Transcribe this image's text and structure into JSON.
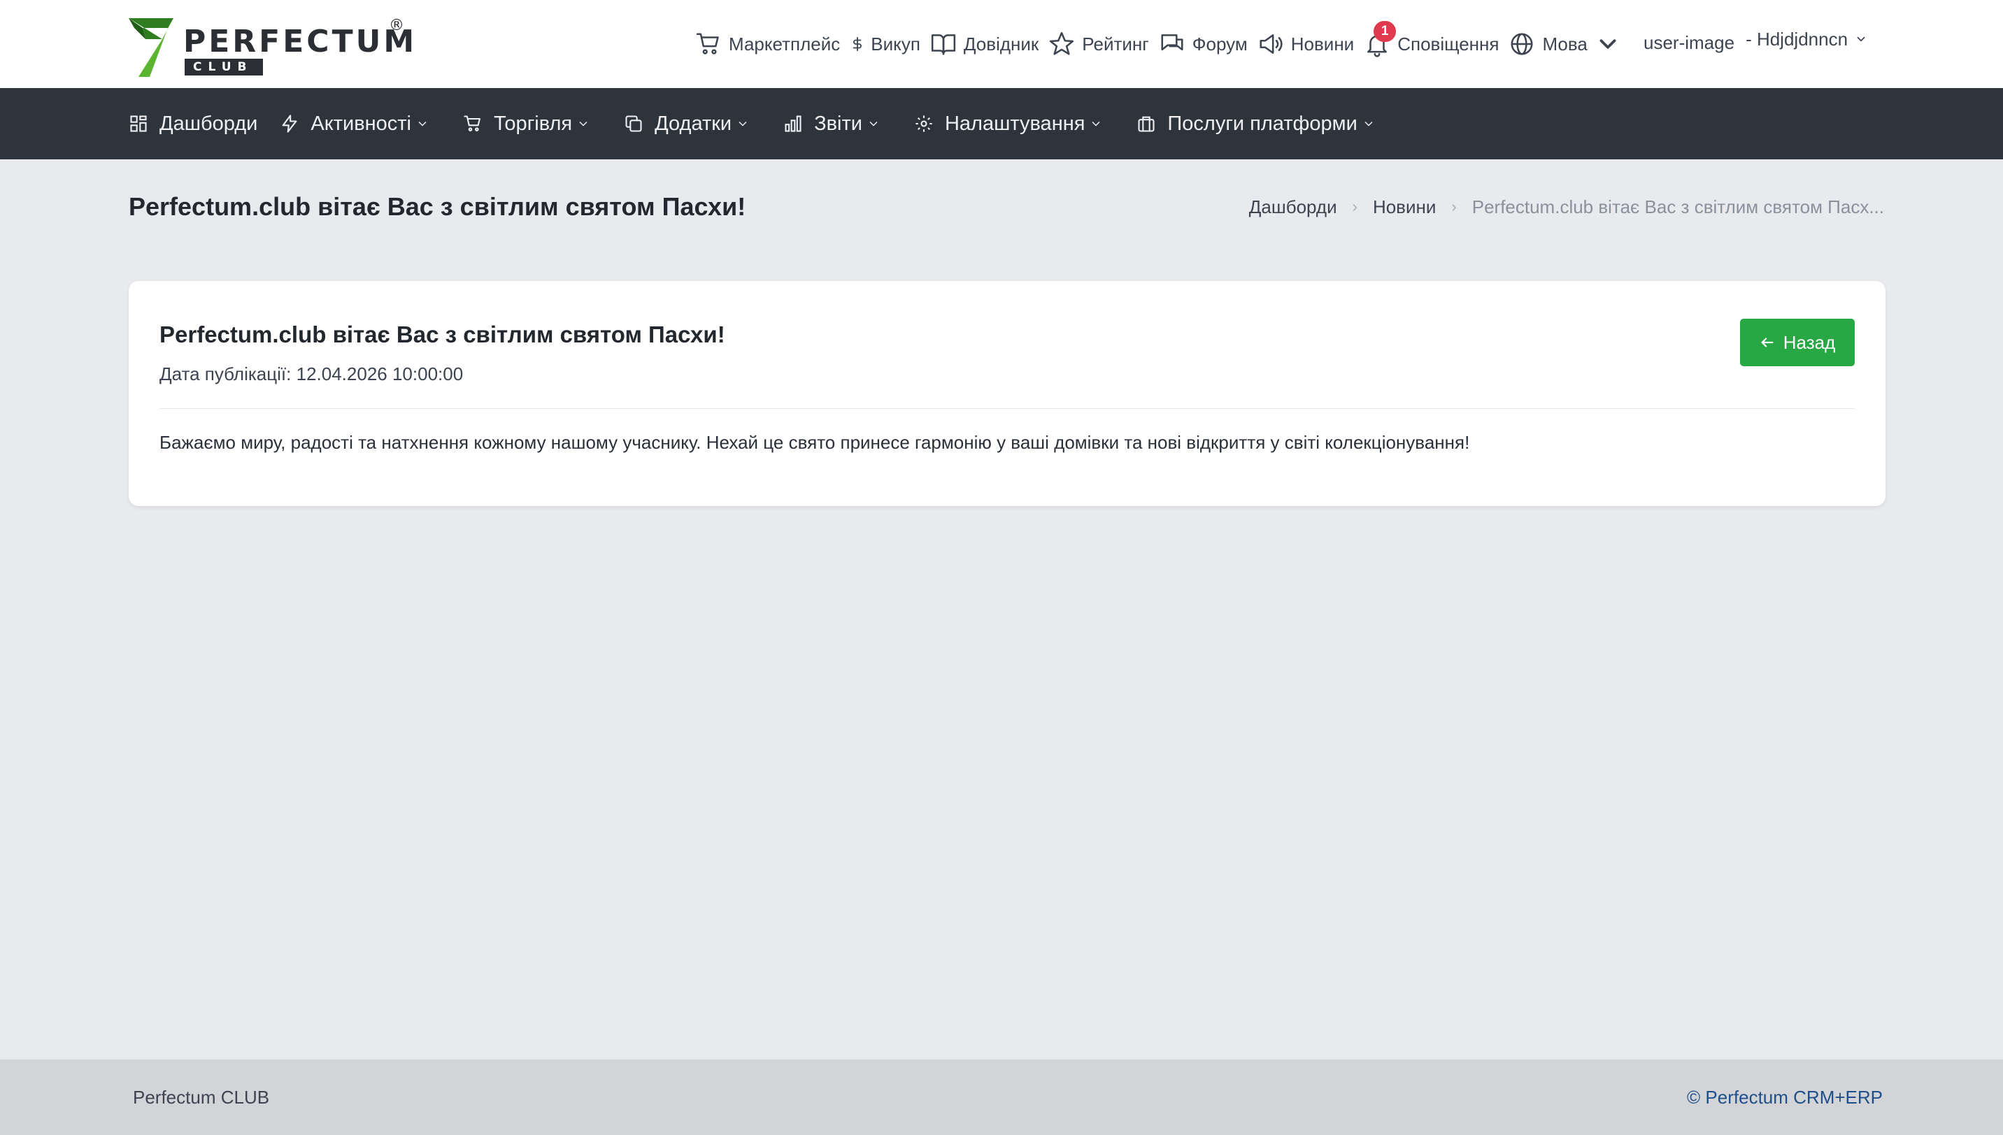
{
  "brand": {
    "word": "PERFECTUM",
    "sub": "CLUB",
    "reg": "®"
  },
  "topnav": {
    "marketplace": "Маркетплейс",
    "buyout": "Викуп",
    "guide": "Довідник",
    "rating": "Рейтинг",
    "forum": "Форум",
    "news": "Новини",
    "notifications": "Сповіщення",
    "notifications_count": "1",
    "language": "Мова"
  },
  "user": {
    "avatar_alt": "user-image",
    "name": "- Hdjdjdnncn"
  },
  "mainnav": {
    "dashboards": "Дашборди",
    "activities": "Активності",
    "trade": "Торгівля",
    "addons": "Додатки",
    "reports": "Звіти",
    "settings": "Налаштування",
    "platform_services": "Послуги платформи"
  },
  "page": {
    "title": "Perfectum.club вітає Вас з світлим святом Пасхи!"
  },
  "breadcrumb": {
    "items": [
      "Дашборди",
      "Новини"
    ],
    "current": "Perfectum.club вітає Вас з світлим святом Пасх..."
  },
  "article": {
    "title": "Perfectum.club вітає Вас з світлим святом Пасхи!",
    "date_label": "Дата публікації:",
    "date_value": "12.04.2026 10:00:00",
    "body": "Бажаємо миру, радості та натхнення кожному нашому учаснику. Нехай це свято принесе гармонію у ваші домівки та нові відкриття у світі колекціонування!",
    "back_label": "Назад"
  },
  "footer": {
    "left": "Perfectum CLUB",
    "right": "© Perfectum CRM+ERP"
  },
  "colors": {
    "nav_bg": "#2e343c",
    "page_bg": "#e8eaee",
    "accent_green": "#28a745",
    "badge_red": "#e03a4e",
    "footer_bg": "#d3d4d7",
    "logo_green": "#3a9a2a"
  }
}
